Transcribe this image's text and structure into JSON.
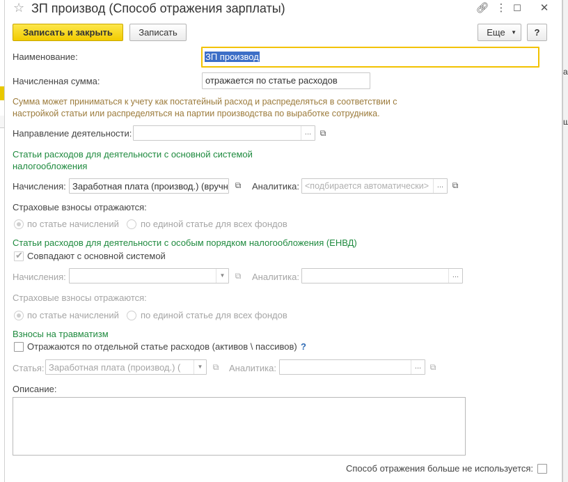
{
  "background": {
    "right_fragment_1": "а",
    "right_fragment_2": "щ"
  },
  "titlebar": {
    "title": "ЗП производ (Способ отражения зарплаты)",
    "icons": [
      "star-icon",
      "link-icon",
      "more-vertical-icon",
      "restore-icon",
      "close-icon"
    ]
  },
  "toolbar": {
    "save_close": "Записать и закрыть",
    "save": "Записать",
    "more": "Еще",
    "help": "?"
  },
  "form": {
    "name_label": "Наименование:",
    "name_value": "ЗП производ",
    "amount_label": "Начисленная сумма:",
    "amount_value": "отражается по статье расходов",
    "hint_line1": "Сумма может приниматься к учету как постатейный расход и распределяться в соответствии с",
    "hint_line2": "настройкой статьи или распределяться на партии производства по выработке сотрудника.",
    "direction_label": "Направление деятельности:",
    "direction_value": "",
    "section1_line1": "Статьи расходов для деятельности с основной системой",
    "section1_line2": "налогообложения",
    "accruals_label": "Начисления:",
    "accruals_value": "Заработная плата (производ.) (вручную)",
    "analytics_label": "Аналитика:",
    "analytics_placeholder": "<подбирается автоматически>",
    "insurance_label": "Страховые взносы отражаются:",
    "radio_by_accrual": "по статье начислений",
    "radio_single": "по единой статье для всех фондов",
    "section2": "Статьи расходов для деятельности с особым порядком налогообложения (ЕНВД)",
    "same_as_main": "Совпадают с основной системой",
    "accruals2_label": "Начисления:",
    "analytics2_label": "Аналитика:",
    "insurance2_label": "Страховые взносы отражаются:",
    "radio2_by_accrual": "по статье начислений",
    "radio2_single": "по единой статье для всех фондов",
    "section3": "Взносы на травматизм",
    "separate_item": "Отражаются по отдельной статье расходов (активов \\ пассивов)",
    "help_q": "?",
    "item_label": "Статья:",
    "item_value": "Заработная плата (производ.) (вручную)",
    "analytics3_label": "Аналитика:",
    "description_label": "Описание:",
    "description_value": "",
    "not_used_label": "Способ отражения больше не используется:"
  }
}
